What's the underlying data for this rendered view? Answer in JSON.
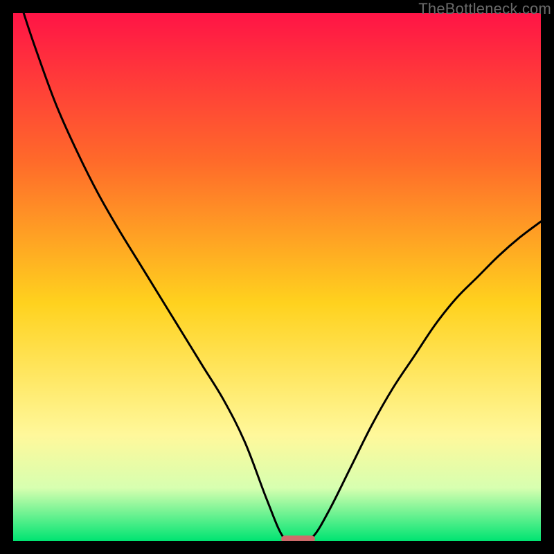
{
  "credit": "TheBottleneck.com",
  "chart_data": {
    "type": "line",
    "title": "",
    "xlabel": "",
    "ylabel": "",
    "xlim": [
      0,
      100
    ],
    "ylim": [
      0,
      100
    ],
    "grid": false,
    "legend": false,
    "gradient_colors": {
      "top": "#ff1446",
      "upper_mid": "#ff6a2a",
      "mid": "#ffd21e",
      "lower_mid": "#fff89b",
      "lower_mid2": "#d7ffb0",
      "bottom": "#00e472"
    },
    "optimum_marker_color": "#ce6b6b",
    "curve_color": "#000000",
    "series": [
      {
        "name": "bottleneck_curve",
        "x": [
          2,
          4,
          8,
          12,
          16,
          20,
          24,
          28,
          32,
          36,
          40,
          44,
          48,
          51,
          53,
          55,
          57,
          60,
          64,
          68,
          72,
          76,
          80,
          84,
          88,
          92,
          96,
          100
        ],
        "y": [
          100,
          94,
          83,
          74,
          66,
          59,
          52.5,
          46,
          39.5,
          33,
          26.5,
          18.5,
          8,
          1,
          0.3,
          0.3,
          1,
          6,
          14,
          22,
          29,
          35,
          41,
          46,
          50,
          54,
          57.5,
          60.5
        ]
      }
    ],
    "optimum_marker": {
      "x_center": 54,
      "x_half_width": 3.2,
      "y": 0.35
    }
  }
}
